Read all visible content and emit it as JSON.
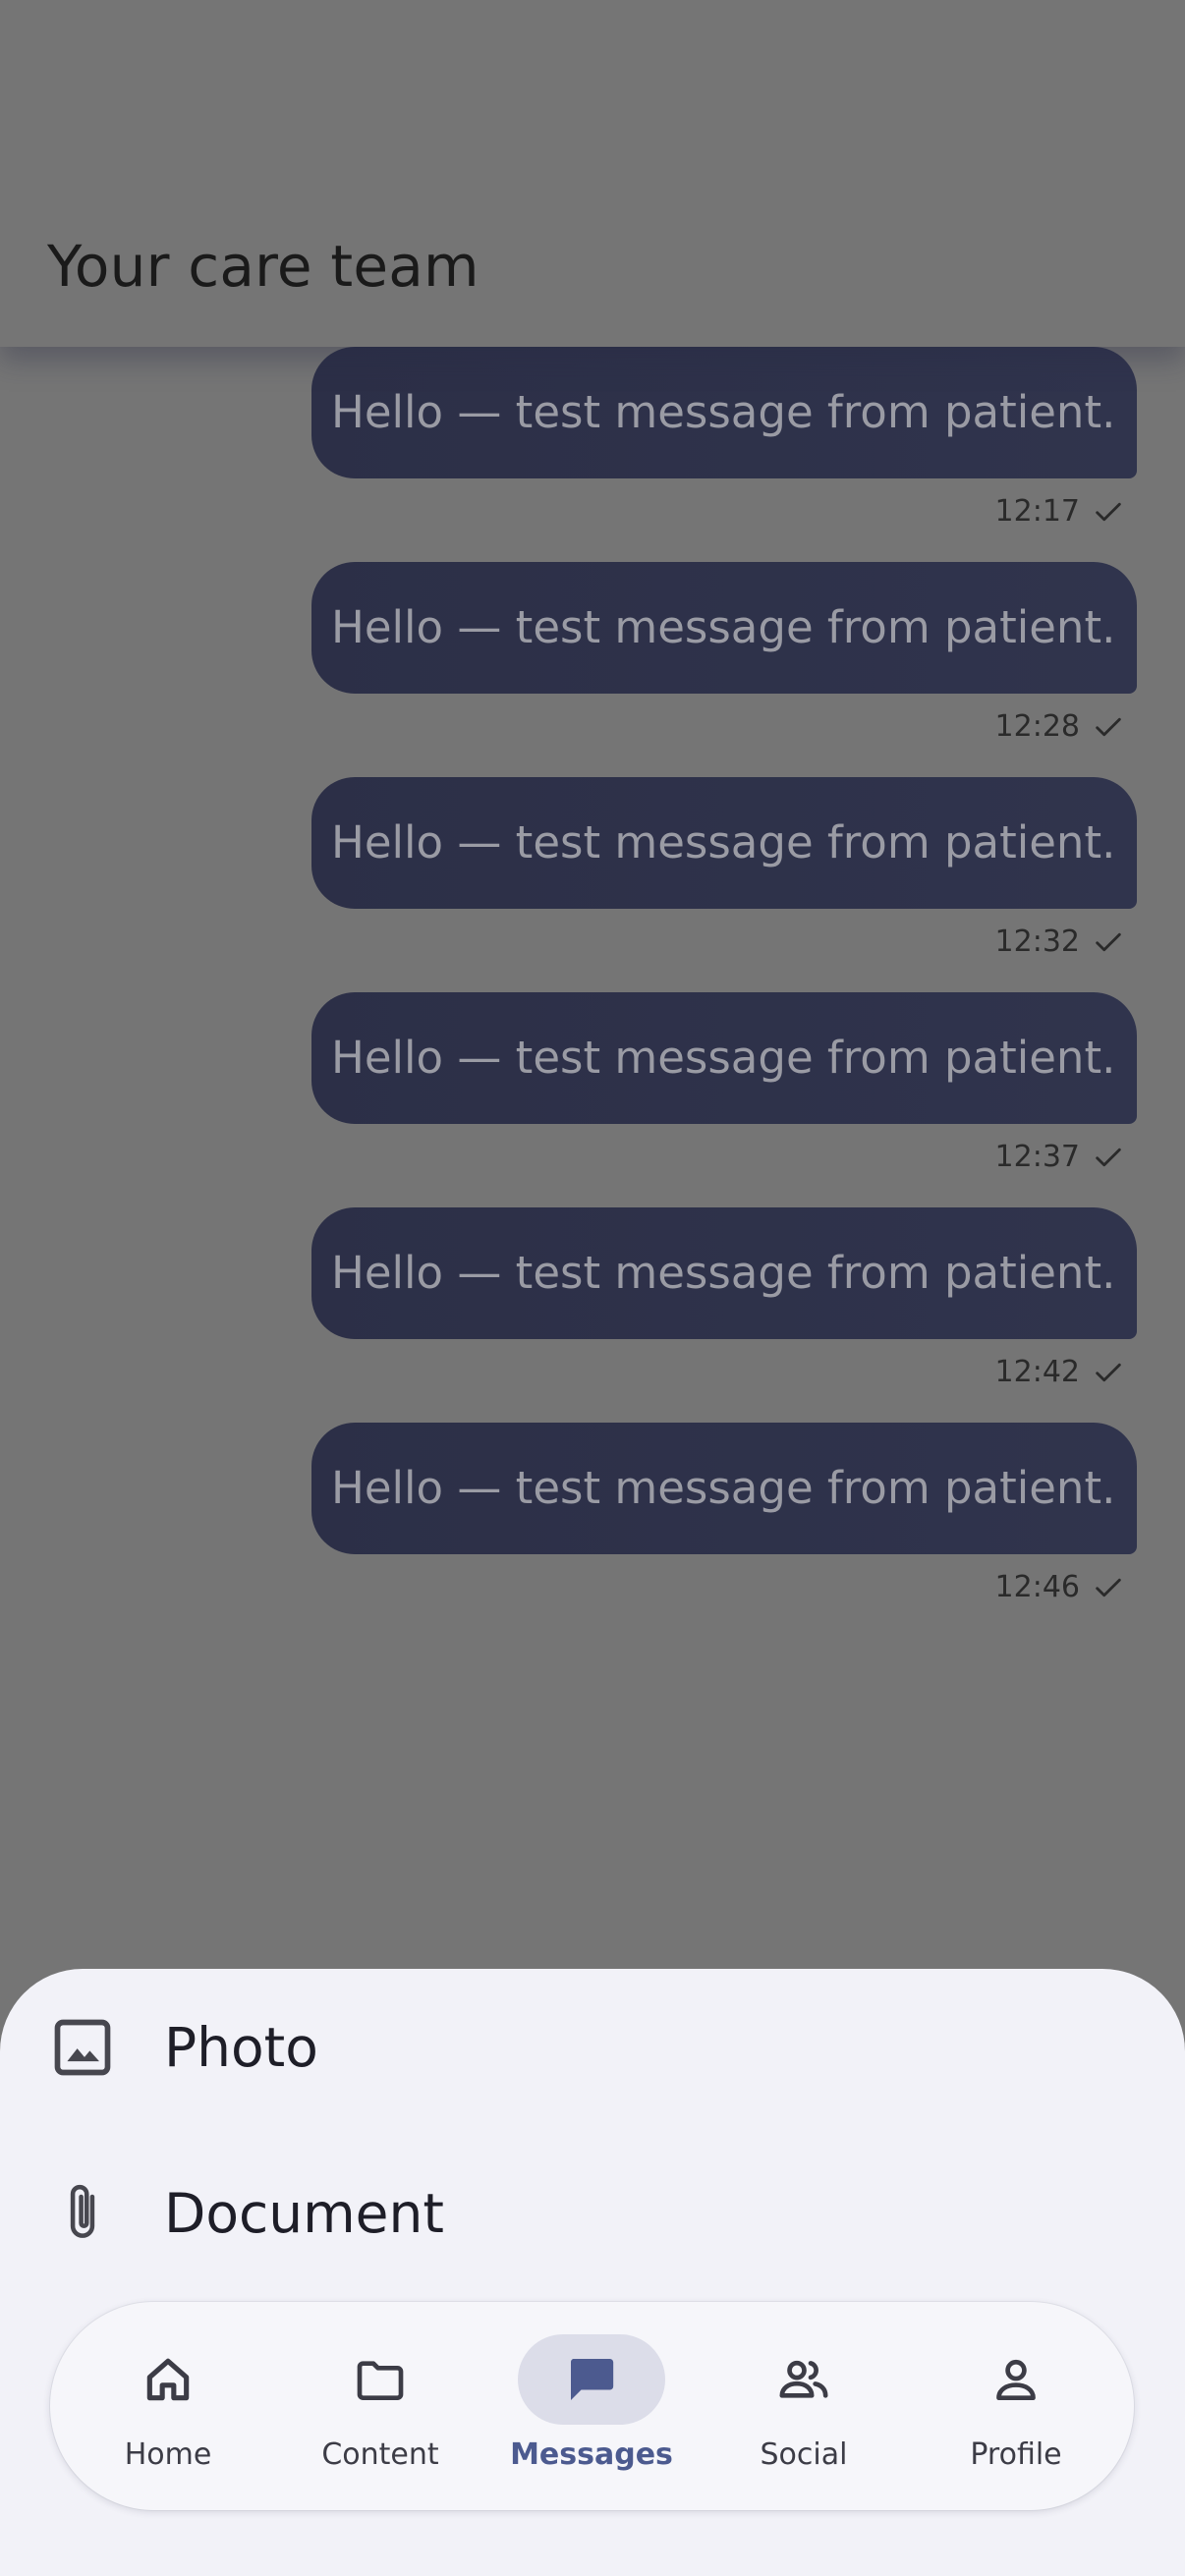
{
  "header": {
    "title": "Your care team"
  },
  "messages": [
    {
      "text": "Hello — test message from patient.",
      "time": "12:17",
      "status_icon": "check-icon"
    },
    {
      "text": "Hello — test message from patient.",
      "time": "12:28",
      "status_icon": "check-icon"
    },
    {
      "text": "Hello — test message from patient.",
      "time": "12:32",
      "status_icon": "check-icon"
    },
    {
      "text": "Hello — test message from patient.",
      "time": "12:37",
      "status_icon": "check-icon"
    },
    {
      "text": "Hello — test message from patient.",
      "time": "12:42",
      "status_icon": "check-icon"
    },
    {
      "text": "Hello — test message from patient.",
      "time": "12:46",
      "status_icon": "check-icon"
    }
  ],
  "attach_sheet": {
    "items": [
      {
        "label": "Photo",
        "icon": "image-icon"
      },
      {
        "label": "Document",
        "icon": "paperclip-icon"
      }
    ]
  },
  "nav": {
    "items": [
      {
        "label": "Home",
        "icon": "home-icon",
        "active": false
      },
      {
        "label": "Content",
        "icon": "folder-icon",
        "active": false
      },
      {
        "label": "Messages",
        "icon": "chat-bubble-icon",
        "active": true
      },
      {
        "label": "Social",
        "icon": "people-icon",
        "active": false
      },
      {
        "label": "Profile",
        "icon": "person-icon",
        "active": false
      }
    ]
  },
  "colors": {
    "scrim_background": "#757575",
    "bubble": "#2e3149",
    "bubble_text": "#9a9ba4",
    "sheet_background": "#f2f2f8",
    "nav_active": "#4c5a8f",
    "nav_active_pill": "#dcdde9"
  }
}
